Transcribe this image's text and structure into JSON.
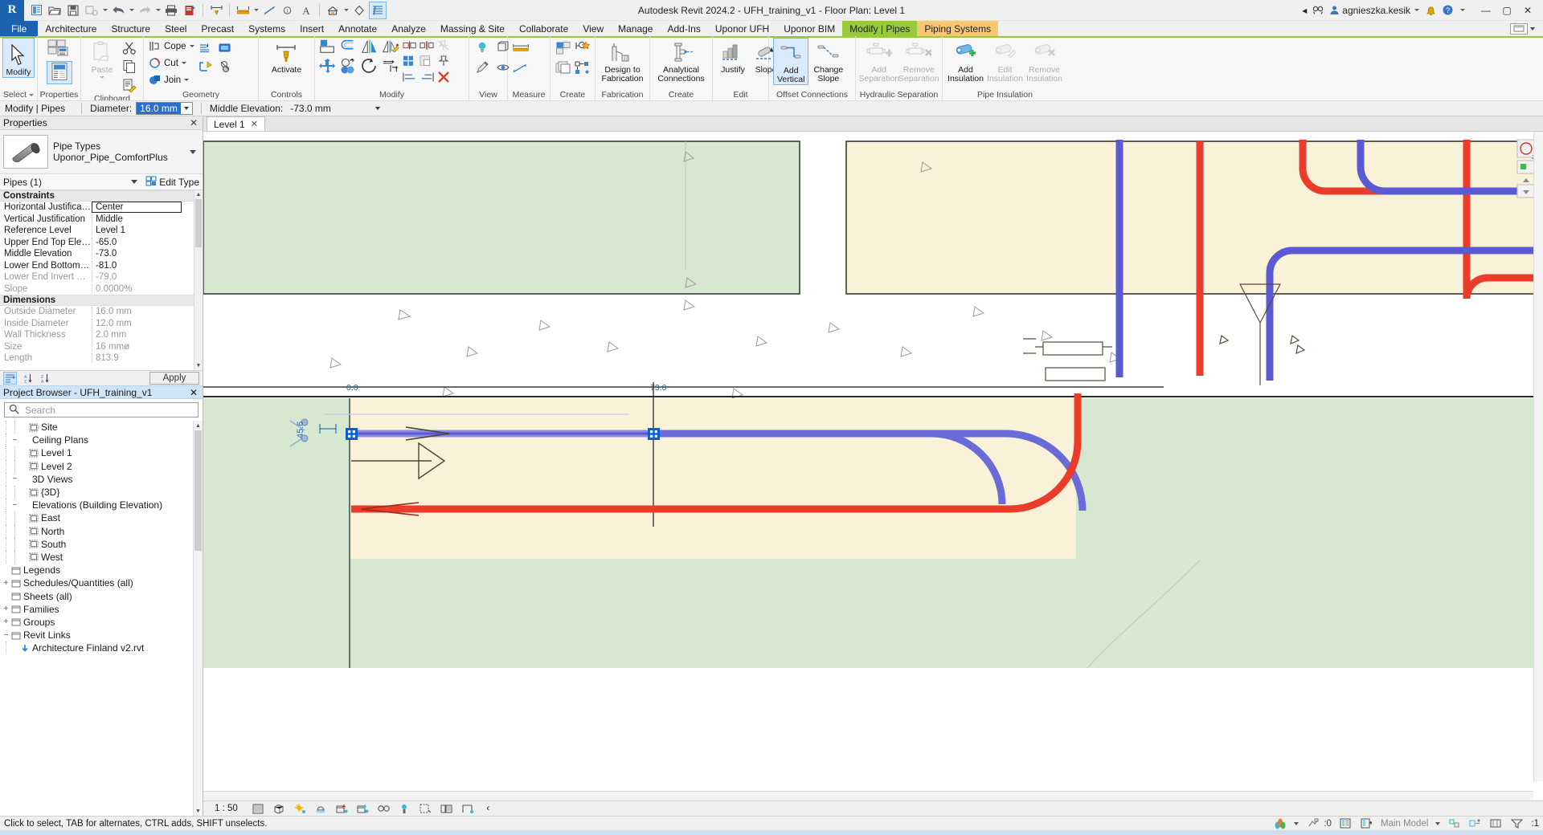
{
  "titlebar": {
    "app_title": "Autodesk Revit 2024.2 - UFH_training_v1 - Floor Plan: Level 1",
    "logo": "R",
    "search_placeholder": "",
    "user": "agnieszka.kesik",
    "quick_access": [
      {
        "name": "home-icon",
        "label": "Home"
      },
      {
        "name": "open-icon",
        "label": "Open"
      },
      {
        "name": "save-icon",
        "label": "Save"
      },
      {
        "name": "save-as-icon",
        "label": "Save As"
      },
      {
        "name": "undo-icon",
        "label": "Undo"
      },
      {
        "name": "redo-icon",
        "label": "Redo"
      },
      {
        "name": "print-icon",
        "label": "Print"
      },
      {
        "name": "measure-icon",
        "label": "Measure"
      },
      {
        "name": "aligned-dimension-icon",
        "label": "Aligned Dimension"
      },
      {
        "name": "tag-icon",
        "label": "Tag"
      },
      {
        "name": "text-icon",
        "label": "Text"
      },
      {
        "name": "default-3d-view-icon",
        "label": "Default 3D View"
      },
      {
        "name": "section-icon",
        "label": "Section"
      },
      {
        "name": "thin-lines-icon",
        "label": "Thin Lines"
      },
      {
        "name": "close-hidden-windows-icon",
        "label": "Close Hidden Windows"
      },
      {
        "name": "switch-windows-icon",
        "label": "Switch Windows"
      }
    ],
    "window_buttons": [
      "minimize",
      "maximize",
      "close"
    ]
  },
  "tabs": [
    {
      "label": "File",
      "type": "file"
    },
    {
      "label": "Architecture",
      "type": "normal"
    },
    {
      "label": "Structure",
      "type": "normal"
    },
    {
      "label": "Steel",
      "type": "normal"
    },
    {
      "label": "Precast",
      "type": "normal"
    },
    {
      "label": "Systems",
      "type": "normal"
    },
    {
      "label": "Insert",
      "type": "normal"
    },
    {
      "label": "Annotate",
      "type": "normal"
    },
    {
      "label": "Analyze",
      "type": "normal"
    },
    {
      "label": "Massing & Site",
      "type": "normal"
    },
    {
      "label": "Collaborate",
      "type": "normal"
    },
    {
      "label": "View",
      "type": "normal"
    },
    {
      "label": "Manage",
      "type": "normal"
    },
    {
      "label": "Add-Ins",
      "type": "normal"
    },
    {
      "label": "Uponor UFH",
      "type": "normal"
    },
    {
      "label": "Uponor BIM",
      "type": "normal"
    },
    {
      "label": "Modify | Pipes",
      "type": "ctx-green"
    },
    {
      "label": "Piping Systems",
      "type": "ctx-orange"
    }
  ],
  "ribbon": {
    "panels": [
      {
        "label": "Select",
        "caret": true,
        "buttons": [
          {
            "label": "Modify",
            "name": "modify-button",
            "selected": true,
            "icon": "cursor-arrow-icon"
          }
        ]
      },
      {
        "label": "Properties",
        "buttons": [
          {
            "label": "",
            "name": "type-properties-button",
            "icon": "type-properties-icon"
          },
          {
            "label": "",
            "name": "properties-palette-button",
            "icon": "properties-palette-icon",
            "selected": true
          }
        ]
      },
      {
        "label": "Clipboard",
        "buttons": [
          {
            "label": "Paste",
            "name": "paste-button",
            "disabled": true,
            "icon": "paste-icon"
          },
          {
            "label": "",
            "name": "cut-clipboard-button",
            "icon": "scissors-icon"
          },
          {
            "label": "",
            "name": "copy-button",
            "icon": "copy-icon"
          },
          {
            "label": "",
            "name": "match-type-button",
            "icon": "match-type-icon"
          }
        ]
      },
      {
        "label": "Geometry",
        "buttons": [
          {
            "label": "Cope",
            "name": "cope-button",
            "icon": "cope-icon",
            "dropdown": true
          },
          {
            "label": "Cut",
            "name": "cut-button",
            "icon": "cut-icon",
            "dropdown": true
          },
          {
            "label": "Join",
            "name": "join-button",
            "icon": "join-icon",
            "dropdown": true
          },
          {
            "label": "",
            "name": "demolish-button",
            "icon": "demolish-icon"
          }
        ]
      },
      {
        "label": "Controls",
        "buttons": [
          {
            "label": "Activate",
            "name": "activate-dimensions-button",
            "icon": "activate-dimensions-icon"
          }
        ]
      },
      {
        "label": "Modify",
        "buttons": [
          {
            "label": "",
            "name": "align-button",
            "icon": "align-icon"
          },
          {
            "label": "",
            "name": "offset-button",
            "icon": "offset-icon"
          },
          {
            "label": "",
            "name": "mirror-pick-axis-button",
            "icon": "mirror-pick-axis-icon"
          },
          {
            "label": "",
            "name": "mirror-draw-axis-button",
            "icon": "mirror-draw-axis-icon"
          },
          {
            "label": "",
            "name": "move-button",
            "icon": "move-icon"
          },
          {
            "label": "",
            "name": "copy-element-button",
            "icon": "copy-element-icon"
          },
          {
            "label": "",
            "name": "rotate-button",
            "icon": "rotate-icon"
          },
          {
            "label": "",
            "name": "trim-extend-button",
            "icon": "trim-extend-icon"
          },
          {
            "label": "",
            "name": "split-button",
            "icon": "split-icon"
          },
          {
            "label": "",
            "name": "array-button",
            "icon": "array-icon"
          },
          {
            "label": "",
            "name": "scale-button",
            "icon": "scale-icon"
          },
          {
            "label": "",
            "name": "pin-button",
            "icon": "pin-icon"
          },
          {
            "label": "",
            "name": "unpin-button",
            "icon": "unpin-icon"
          },
          {
            "label": "",
            "name": "delete-button",
            "icon": "delete-icon"
          }
        ]
      },
      {
        "label": "View",
        "buttons": [
          {
            "label": "",
            "name": "visibility-graphics-button",
            "icon": "lightbulb-icon"
          },
          {
            "label": "",
            "name": "paint-button",
            "icon": "paint-icon"
          },
          {
            "label": "",
            "name": "view-3d-button",
            "icon": "view-3d-icon"
          },
          {
            "label": "",
            "name": "hide-override-button",
            "icon": "hide-override-icon"
          }
        ]
      },
      {
        "label": "Measure",
        "buttons": [
          {
            "label": "",
            "name": "measure-between-button",
            "icon": "measure-tape-icon",
            "dropdown": true
          },
          {
            "label": "",
            "name": "measure-along-button",
            "icon": "measure-along-icon",
            "dropdown": true
          }
        ]
      },
      {
        "label": "Create",
        "buttons": [
          {
            "label": "",
            "name": "create-similar-button",
            "icon": "create-similar-icon"
          },
          {
            "label": "",
            "name": "create-group-button",
            "icon": "create-group-icon"
          },
          {
            "label": "",
            "name": "create-part-button",
            "icon": "create-part-icon"
          },
          {
            "label": "",
            "name": "create-assembly-button",
            "icon": "create-assembly-icon"
          }
        ]
      },
      {
        "label": "Fabrication",
        "buttons": [
          {
            "label": "Design to\nFabrication",
            "name": "design-to-fabrication-button",
            "icon": "factory-icon"
          }
        ]
      },
      {
        "label": "Create",
        "buttons": [
          {
            "label": "Analytical\nConnections",
            "name": "analytical-connections-button",
            "icon": "pipe-connection-icon"
          }
        ]
      },
      {
        "label": "Edit",
        "buttons": [
          {
            "label": "Justify",
            "name": "justify-button",
            "icon": "justify-icon"
          },
          {
            "label": "Slope",
            "name": "slope-button",
            "icon": "slope-icon"
          }
        ]
      },
      {
        "label": "Offset Connections",
        "buttons": [
          {
            "label": "Add\nVertical",
            "name": "add-vertical-button",
            "icon": "add-vertical-icon",
            "selected": true
          },
          {
            "label": "Change\nSlope",
            "name": "change-slope-button",
            "icon": "change-slope-icon"
          }
        ]
      },
      {
        "label": "Hydraulic Separation",
        "buttons": [
          {
            "label": "Add\nSeparation",
            "name": "add-separation-button",
            "icon": "add-separation-icon",
            "disabled": true
          },
          {
            "label": "Remove\nSeparation",
            "name": "remove-separation-button",
            "icon": "remove-separation-icon",
            "disabled": true
          }
        ]
      },
      {
        "label": "Pipe Insulation",
        "buttons": [
          {
            "label": "Add\nInsulation",
            "name": "add-insulation-button",
            "icon": "add-insulation-icon"
          },
          {
            "label": "Edit\nInsulation",
            "name": "edit-insulation-button",
            "icon": "edit-insulation-icon",
            "disabled": true
          },
          {
            "label": "Remove\nInsulation",
            "name": "remove-insulation-button",
            "icon": "remove-insulation-icon",
            "disabled": true
          }
        ]
      }
    ]
  },
  "options_bar": {
    "context": "Modify | Pipes",
    "diameter_label": "Diameter:",
    "diameter_value": "16.0 mm",
    "middle_elevation_label": "Middle Elevation:",
    "middle_elevation_value": "-73.0 mm"
  },
  "properties": {
    "title": "Properties",
    "type_category": "Pipe Types",
    "type_name": "Uponor_Pipe_ComfortPlus",
    "selector": "Pipes (1)",
    "edit_type": "Edit Type",
    "apply": "Apply",
    "groups": [
      {
        "name": "Constraints",
        "rows": [
          {
            "key": "Horizontal Justification",
            "value": "Center",
            "dim": false,
            "boxed": true
          },
          {
            "key": "Vertical Justification",
            "value": "Middle",
            "dim": false
          },
          {
            "key": "Reference Level",
            "value": "Level 1",
            "dim": false
          },
          {
            "key": "Upper End Top Elevation",
            "value": "-65.0",
            "dim": false
          },
          {
            "key": "Middle Elevation",
            "value": "-73.0",
            "dim": false
          },
          {
            "key": "Lower End Bottom Ele...",
            "value": "-81.0",
            "dim": false
          },
          {
            "key": "Lower End Invert Eleva...",
            "value": "-79.0",
            "dim": true
          },
          {
            "key": "Slope",
            "value": "0.0000%",
            "dim": true
          }
        ]
      },
      {
        "name": "Dimensions",
        "rows": [
          {
            "key": "Outside Diameter",
            "value": "16.0 mm",
            "dim": true
          },
          {
            "key": "Inside Diameter",
            "value": "12.0 mm",
            "dim": true
          },
          {
            "key": "Wall Thickness",
            "value": "2.0 mm",
            "dim": true
          },
          {
            "key": "Size",
            "value": "16 mmø",
            "dim": true
          },
          {
            "key": "Length",
            "value": "813.9",
            "dim": true
          }
        ]
      }
    ]
  },
  "project_browser": {
    "title": "Project Browser - UFH_training_v1",
    "search_placeholder": "Search",
    "search_value": "",
    "items": [
      {
        "label": "Site",
        "depth": 2,
        "type": "view",
        "toggle": ""
      },
      {
        "label": "Ceiling Plans",
        "depth": 1,
        "type": "group",
        "toggle": "−"
      },
      {
        "label": "Level 1",
        "depth": 2,
        "type": "view",
        "toggle": ""
      },
      {
        "label": "Level 2",
        "depth": 2,
        "type": "view",
        "toggle": ""
      },
      {
        "label": "3D Views",
        "depth": 1,
        "type": "group",
        "toggle": "−"
      },
      {
        "label": "{3D}",
        "depth": 2,
        "type": "view",
        "toggle": ""
      },
      {
        "label": "Elevations (Building Elevation)",
        "depth": 1,
        "type": "group",
        "toggle": "−"
      },
      {
        "label": "East",
        "depth": 2,
        "type": "view",
        "toggle": ""
      },
      {
        "label": "North",
        "depth": 2,
        "type": "view",
        "toggle": ""
      },
      {
        "label": "South",
        "depth": 2,
        "type": "view",
        "toggle": ""
      },
      {
        "label": "West",
        "depth": 2,
        "type": "view",
        "toggle": ""
      },
      {
        "label": "Legends",
        "depth": 0,
        "type": "folder",
        "toggle": ""
      },
      {
        "label": "Schedules/Quantities (all)",
        "depth": 0,
        "type": "folder",
        "toggle": "+"
      },
      {
        "label": "Sheets (all)",
        "depth": 0,
        "type": "folder",
        "toggle": ""
      },
      {
        "label": "Families",
        "depth": 0,
        "type": "folder",
        "toggle": "+"
      },
      {
        "label": "Groups",
        "depth": 0,
        "type": "folder",
        "toggle": "+"
      },
      {
        "label": "Revit Links",
        "depth": 0,
        "type": "folder",
        "toggle": "−"
      },
      {
        "label": "Architecture Finland v2.rvt",
        "depth": 1,
        "type": "link",
        "toggle": ""
      }
    ]
  },
  "view_tab": {
    "label": "Level 1"
  },
  "canvas": {
    "grid_labels": [
      "0.0",
      "73.0"
    ],
    "dimension_text": "45.6",
    "colors": {
      "supply_pipe": "#ea3c2a",
      "return_pipe": "#5a5ad4",
      "selected_pipe": "#6a6ad8",
      "room_green": "#d7e8d0",
      "room_cream": "#faf2d8",
      "selection_handle": "#0b5fd6"
    }
  },
  "view_control_bar": {
    "scale": "1 : 50",
    "icons": [
      {
        "name": "detail-level-icon"
      },
      {
        "name": "visual-style-icon"
      },
      {
        "name": "sun-path-icon"
      },
      {
        "name": "shadows-icon"
      },
      {
        "name": "rendering-dialog-icon"
      },
      {
        "name": "crop-view-icon"
      },
      {
        "name": "show-crop-region-icon"
      },
      {
        "name": "analytical-model-icon"
      },
      {
        "name": "temporary-hide-isolate-icon"
      },
      {
        "name": "reveal-hidden-elements-icon"
      },
      {
        "name": "temporary-view-properties-icon"
      },
      {
        "name": "hide-crop-boundaries-icon"
      },
      {
        "name": "expand-icon"
      }
    ]
  },
  "status_bar": {
    "message": "Click to select, TAB for alternates, CTRL adds, SHIFT unselects.",
    "warning_count": ":0",
    "worksets": "Main Model",
    "filter_count": ":1",
    "icons": [
      {
        "name": "design-options-icon"
      },
      {
        "name": "editable-only-icon"
      },
      {
        "name": "worksets-icon"
      },
      {
        "name": "exclude-options-icon"
      },
      {
        "name": "filter-icon"
      }
    ]
  }
}
